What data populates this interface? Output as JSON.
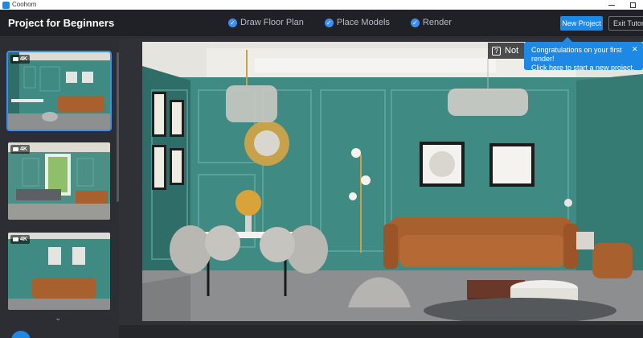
{
  "window": {
    "app_name": "Coohom",
    "logo_icon": "coohom-logo-icon",
    "controls": [
      "minimize-icon",
      "maximize-icon"
    ]
  },
  "header": {
    "project_title": "Project for Beginners",
    "steps": [
      {
        "label": "Draw Floor Plan",
        "icon": "check-circle-icon"
      },
      {
        "label": "Place Models",
        "icon": "check-circle-icon"
      },
      {
        "label": "Render",
        "icon": "check-circle-icon"
      }
    ],
    "new_project_label": "New Project",
    "exit_tutorial_label": "Exit Tutoria"
  },
  "toast": {
    "line1": "Congratulations on your first render!",
    "line2": "Click here to start a new project.",
    "close_icon": "close-icon"
  },
  "sidebar": {
    "thumbnails": [
      {
        "badge": "4K",
        "selected": true
      },
      {
        "badge": "4K",
        "selected": false
      },
      {
        "badge": "4K",
        "selected": false
      }
    ],
    "scroll_icon": "chevron-down-icon"
  },
  "render_overlay": {
    "label": "Not",
    "icon": "help-square-icon"
  },
  "colors": {
    "accent": "#1e88e5",
    "header_bg": "#1f2126",
    "sidebar_bg": "#2c2e33",
    "wall_teal": "#3f8a82"
  }
}
